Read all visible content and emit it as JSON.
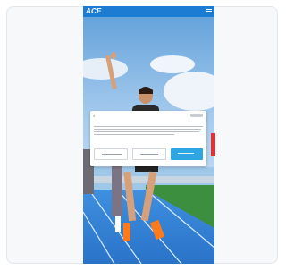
{
  "site": {
    "logo_text": "ACE"
  },
  "colors": {
    "header": "#1c7bd3",
    "accent": "#2ea6e3",
    "side_tab": "#e03232"
  },
  "icons": {
    "menu": "hamburger-menu-icon",
    "close": "close-icon"
  }
}
